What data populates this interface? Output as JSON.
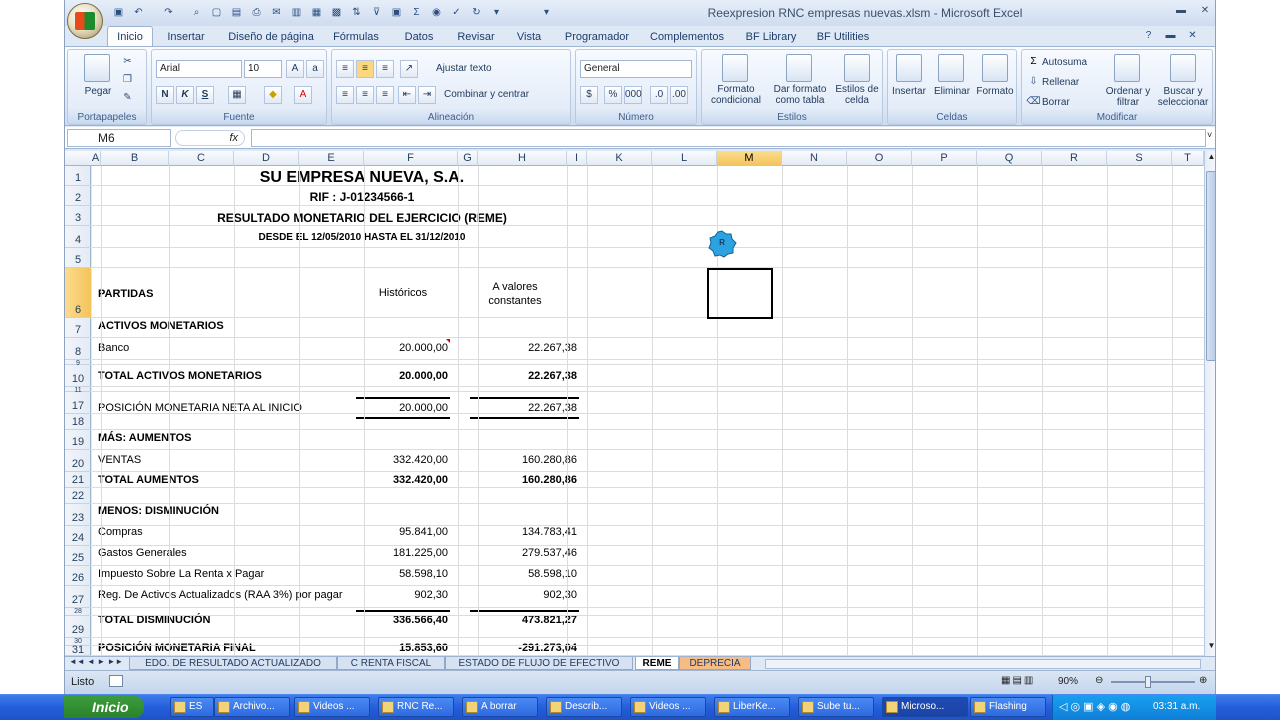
{
  "window": {
    "title": "Reexpresion RNC empresas nuevas.xlsm - Microsoft Excel"
  },
  "ribbon_tabs": [
    "Inicio",
    "Insertar",
    "Diseño de página",
    "Fórmulas",
    "Datos",
    "Revisar",
    "Vista",
    "Programador",
    "Complementos",
    "BF Library",
    "BF Utilities"
  ],
  "ribbon": {
    "clipboard": {
      "paste": "Pegar",
      "label": "Portapapeles"
    },
    "font": {
      "name": "Arial",
      "size": "10",
      "label": "Fuente",
      "bold": "N",
      "italic": "K",
      "underline": "S"
    },
    "alignment": {
      "wrap": "Ajustar texto",
      "merge": "Combinar y centrar",
      "label": "Alineación"
    },
    "number": {
      "format": "General",
      "label": "Número"
    },
    "styles": {
      "cond": "Formato condicional",
      "table": "Dar formato como tabla",
      "cell": "Estilos de celda",
      "label": "Estilos"
    },
    "cells": {
      "insert": "Insertar",
      "delete": "Eliminar",
      "format": "Formato",
      "label": "Celdas"
    },
    "editing": {
      "autosum": "Autosuma",
      "fill": "Rellenar",
      "clear": "Borrar",
      "sort": "Ordenar y filtrar",
      "find": "Buscar y seleccionar",
      "label": "Modificar"
    }
  },
  "formula_bar": {
    "name_box": "M6",
    "fx": "fx",
    "value": ""
  },
  "columns": [
    "A",
    "B",
    "C",
    "D",
    "E",
    "F",
    "G",
    "H",
    "I",
    "K",
    "L",
    "M",
    "N",
    "O",
    "P",
    "Q",
    "R",
    "S",
    "T"
  ],
  "rows": [
    "1",
    "2",
    "3",
    "4",
    "5",
    "6",
    "7",
    "8",
    "9",
    "10",
    "11",
    "17",
    "18",
    "19",
    "20",
    "21",
    "22",
    "23",
    "24",
    "25",
    "26",
    "27",
    "28",
    "29",
    "30",
    "31"
  ],
  "sheet": {
    "company": "SU EMPRESA NUEVA, S.A.",
    "rif": "RIF : J-01234566-1",
    "report": "RESULTADO MONETARIO DEL EJERCICIO (REME)",
    "period": "DESDE EL 12/05/2010 HASTA EL 31/12/2010",
    "col_partidas": "PARTIDAS",
    "col_hist": "Históricos",
    "col_const": "A valores constantes",
    "lines": [
      {
        "label": "ACTIVOS MONETARIOS",
        "hist": "",
        "const": "",
        "bold": true
      },
      {
        "label": "Banco",
        "hist": "20.000,00",
        "const": "22.267,38",
        "bold": false
      },
      {
        "label": "TOTAL ACTIVOS MONETARIOS",
        "hist": "20.000,00",
        "const": "22.267,38",
        "bold": true
      },
      {
        "label": "POSICIÓN MONETARIA NETA AL INICIO",
        "hist": "20.000,00",
        "const": "22.267,38",
        "bold": false
      },
      {
        "label": "MÁS: AUMENTOS",
        "hist": "",
        "const": "",
        "bold": true
      },
      {
        "label": "VENTAS",
        "hist": "332.420,00",
        "const": "160.280,86",
        "bold": false
      },
      {
        "label": "TOTAL AUMENTOS",
        "hist": "332.420,00",
        "const": "160.280,86",
        "bold": true
      },
      {
        "label": "MENOS: DISMINUCIÓN",
        "hist": "",
        "const": "",
        "bold": true
      },
      {
        "label": "Compras",
        "hist": "95.841,00",
        "const": "134.783,41",
        "bold": false
      },
      {
        "label": "Gastos Generales",
        "hist": "181.225,00",
        "const": "279.537,46",
        "bold": false
      },
      {
        "label": "Impuesto Sobre La Renta x Pagar",
        "hist": "58.598,10",
        "const": "58.598,10",
        "bold": false
      },
      {
        "label": "Reg. De Activos Actualizados (RAA 3%) por pagar",
        "hist": "902,30",
        "const": "902,30",
        "bold": false
      },
      {
        "label": "TOTAL DISMINUCIÓN",
        "hist": "336.566,40",
        "const": "473.821,27",
        "bold": true
      },
      {
        "label": "POSICIÓN MONETARIA FINAL",
        "hist": "15.853,60",
        "const": "-291.273,04",
        "bold": true
      }
    ],
    "marker": "R"
  },
  "sheet_tabs": [
    "EDO. DE RESULTADO ACTUALIZADO",
    "C RENTA FISCAL",
    "ESTADO DE FLUJO DE EFECTIVO",
    "REME",
    "DEPRECIA"
  ],
  "status": {
    "mode": "Listo",
    "zoom": "90%"
  },
  "taskbar": {
    "start": "Inicio",
    "items": [
      "ES",
      "Archivo...",
      "Videos ...",
      "RNC Re...",
      "A borrar",
      "Describ...",
      "Videos ...",
      "LiberKe...",
      "Sube tu...",
      "Microso...",
      "Flashing"
    ],
    "clock": "03:31 a.m."
  }
}
